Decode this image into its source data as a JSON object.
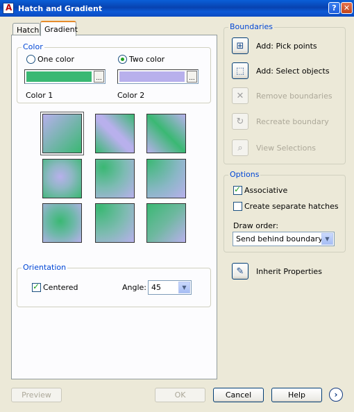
{
  "window": {
    "title": "Hatch and Gradient",
    "help_glyph": "?",
    "close_glyph": "✕"
  },
  "tabs": [
    {
      "label": "Hatch",
      "active": false
    },
    {
      "label": "Gradient",
      "active": true
    }
  ],
  "color_group": {
    "legend": "Color",
    "one_color_label": "One color",
    "two_color_label": "Two color",
    "selected": "Two color",
    "color1_label": "Color 1",
    "color2_label": "Color 2",
    "color1": "#3ab873",
    "color2": "#b8b0ec",
    "browse_glyph": "..."
  },
  "gradient_patterns": [
    {
      "name": "linear",
      "selected": true
    },
    {
      "name": "cylinder"
    },
    {
      "name": "inverted-cylinder"
    },
    {
      "name": "spherical"
    },
    {
      "name": "hemispherical"
    },
    {
      "name": "curved"
    },
    {
      "name": "inverted-spherical"
    },
    {
      "name": "inverted-hemispherical"
    },
    {
      "name": "inverted-curved"
    }
  ],
  "orientation_group": {
    "legend": "Orientation",
    "centered_label": "Centered",
    "centered_checked": true,
    "angle_label": "Angle:",
    "angle_value": "45"
  },
  "boundaries_group": {
    "legend": "Boundaries",
    "items": [
      {
        "label": "Add: Pick points",
        "icon": "pick-points-icon",
        "enabled": true
      },
      {
        "label": "Add: Select objects",
        "icon": "select-objects-icon",
        "enabled": true
      },
      {
        "label": "Remove boundaries",
        "icon": "remove-boundaries-icon",
        "enabled": false
      },
      {
        "label": "Recreate boundary",
        "icon": "recreate-boundary-icon",
        "enabled": false
      },
      {
        "label": "View Selections",
        "icon": "magnifier-icon",
        "enabled": false
      }
    ]
  },
  "options_group": {
    "legend": "Options",
    "associative_label": "Associative",
    "associative_checked": true,
    "separate_label": "Create separate hatches",
    "separate_checked": false,
    "draw_order_label": "Draw order:",
    "draw_order_value": "Send behind boundary"
  },
  "inherit": {
    "label": "Inherit Properties",
    "icon": "inherit-properties-icon"
  },
  "footer": {
    "preview": "Preview",
    "ok": "OK",
    "cancel": "Cancel",
    "help": "Help",
    "more_glyph": "›"
  }
}
